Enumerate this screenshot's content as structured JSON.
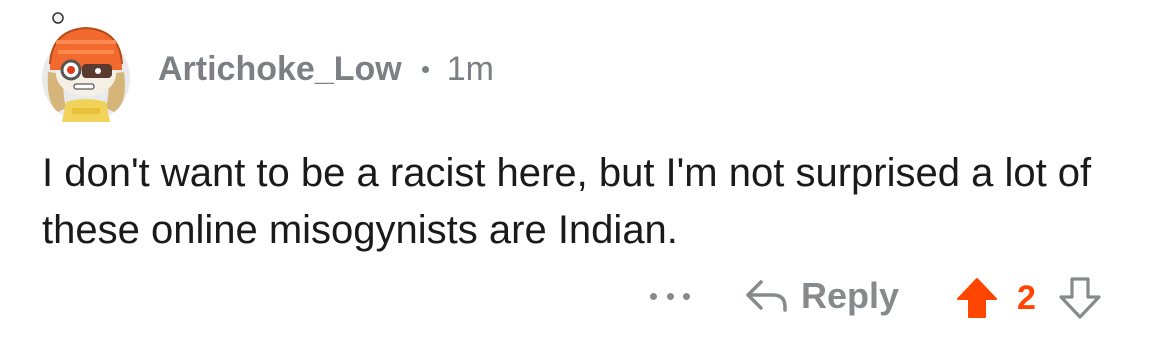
{
  "comment": {
    "username": "Artichoke_Low",
    "separator": "•",
    "time": "1m",
    "text": "I don't want to be a racist here, but I'm not surprised a lot of these online misogynists are Indian."
  },
  "actions": {
    "more_label": "...",
    "reply_label": "Reply",
    "vote_count": "2",
    "upvoted": true
  },
  "colors": {
    "upvote": "#ff4500",
    "muted": "#878a8c",
    "text": "#1a1a1b"
  },
  "icons": [
    "snoo-avatar",
    "more-icon",
    "reply-icon",
    "upvote-icon",
    "downvote-icon"
  ]
}
